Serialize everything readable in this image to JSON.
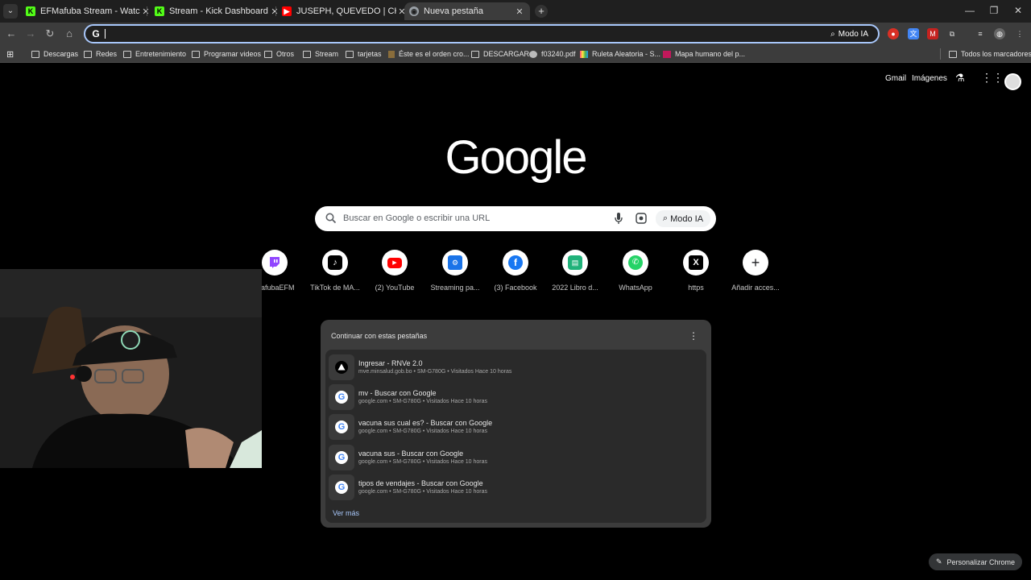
{
  "tabs": [
    {
      "title": "EFMafuba Stream - Watch Live",
      "favicon": "kick-icon"
    },
    {
      "title": "Stream - Kick Dashboard",
      "favicon": "kick-icon"
    },
    {
      "title": "JUSEPH, QUEVEDO | CHUOS (V",
      "favicon": "youtube-icon"
    },
    {
      "title": "Nueva pestaña",
      "favicon": "chrome-icon",
      "active": true
    }
  ],
  "window_controls": {
    "minimize": "—",
    "maximize": "❐",
    "close": "✕"
  },
  "omnibox": {
    "value": "",
    "ai_label": "Modo IA"
  },
  "bookmarks": [
    {
      "label": "Descargas",
      "type": "folder"
    },
    {
      "label": "Redes",
      "type": "folder"
    },
    {
      "label": "Entretenimiento",
      "type": "folder"
    },
    {
      "label": "Programar videos",
      "type": "folder"
    },
    {
      "label": "Otros",
      "type": "folder"
    },
    {
      "label": "Stream",
      "type": "folder"
    },
    {
      "label": "tarjetas",
      "type": "folder"
    },
    {
      "label": "Éste es el orden cro...",
      "type": "link"
    },
    {
      "label": "DESCARGAR",
      "type": "folder"
    },
    {
      "label": "f03240.pdf",
      "type": "link"
    },
    {
      "label": "Ruleta Aleatoria - S...",
      "type": "link"
    },
    {
      "label": "Mapa humano del p...",
      "type": "link"
    }
  ],
  "all_bookmarks_label": "Todos los marcadores",
  "header_links": {
    "gmail": "Gmail",
    "images": "Imágenes"
  },
  "logo_text": "Google",
  "search": {
    "placeholder": "Buscar en Google o escribir una URL",
    "ai_label": "Modo IA"
  },
  "shortcuts": [
    {
      "label": "MafubaEFM",
      "icon": "twitch-icon"
    },
    {
      "label": "TikTok de MA...",
      "icon": "tiktok-icon"
    },
    {
      "label": "(2) YouTube",
      "icon": "youtube-icon"
    },
    {
      "label": "Streaming pa...",
      "icon": "streaming-icon"
    },
    {
      "label": "(3) Facebook",
      "icon": "facebook-icon"
    },
    {
      "label": "2022 Libro d...",
      "icon": "book-icon"
    },
    {
      "label": "WhatsApp",
      "icon": "whatsapp-icon"
    },
    {
      "label": "https",
      "icon": "x-icon"
    },
    {
      "label": "Añadir acces...",
      "icon": "plus-icon"
    }
  ],
  "continue_card": {
    "header": "Continuar con estas pestañas",
    "more_label": "Ver más",
    "items": [
      {
        "title": "Ingresar - RNVe 2.0",
        "subtitle": "mve.minsalud.gob.bo • SM-G780G • Visitados Hace 10 horas",
        "icon": "triangle-icon"
      },
      {
        "title": "mv - Buscar con Google",
        "subtitle": "google.com • SM-G780G • Visitados Hace 10 horas",
        "icon": "google-icon"
      },
      {
        "title": "vacuna sus cual es? - Buscar con Google",
        "subtitle": "google.com • SM-G780G • Visitados Hace 10 horas",
        "icon": "google-icon"
      },
      {
        "title": "vacuna sus - Buscar con Google",
        "subtitle": "google.com • SM-G780G • Visitados Hace 10 horas",
        "icon": "google-icon"
      },
      {
        "title": "tipos de vendajes - Buscar con Google",
        "subtitle": "google.com • SM-G780G • Visitados Hace 10 horas",
        "icon": "google-icon"
      }
    ]
  },
  "customize_label": "Personalizar Chrome",
  "colors": {
    "accent": "#a8c7fa",
    "kick": "#53fc18",
    "youtube": "#ff0000",
    "twitch": "#9146ff",
    "facebook": "#1877f2",
    "whatsapp": "#25d366"
  }
}
